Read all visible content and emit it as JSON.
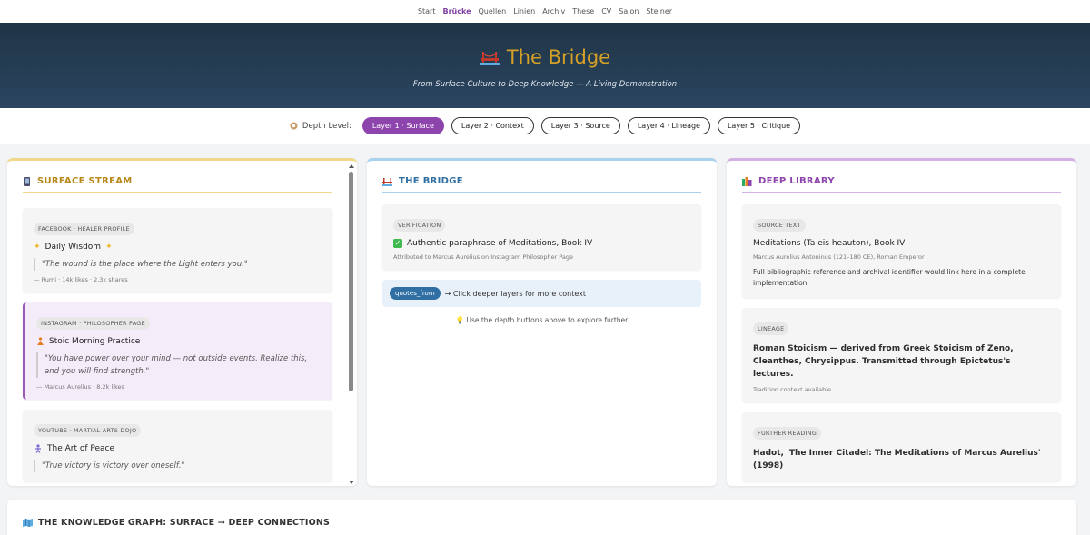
{
  "nav": {
    "items": [
      {
        "label": "Start",
        "active": false
      },
      {
        "label": "Brücke",
        "active": true
      },
      {
        "label": "Quellen",
        "active": false
      },
      {
        "label": "Linien",
        "active": false
      },
      {
        "label": "Archiv",
        "active": false
      },
      {
        "label": "These",
        "active": false
      },
      {
        "label": "CV",
        "active": false
      },
      {
        "label": "Sajon",
        "active": false
      },
      {
        "label": "Steiner",
        "active": false
      }
    ]
  },
  "hero": {
    "title": "The Bridge",
    "subtitle": "From Surface Culture to Deep Knowledge — A Living Demonstration",
    "icon": "bridge-icon"
  },
  "depth": {
    "label": "Depth Level:",
    "buttons": [
      "Layer 1 · Surface",
      "Layer 2 · Context",
      "Layer 3 · Source",
      "Layer 4 · Lineage",
      "Layer 5 · Critique"
    ],
    "active_index": 0
  },
  "surface": {
    "heading": "SURFACE STREAM",
    "cards": [
      {
        "tag": "FACEBOOK · HEALER PROFILE",
        "title": "Daily Wisdom",
        "quote": "\"The wound is the place where the Light enters you.\"",
        "meta": "— Rumi · 14k likes · 2.3k shares"
      },
      {
        "tag": "INSTAGRAM · PHILOSOPHER PAGE",
        "title": "Stoic Morning Practice",
        "quote": "\"You have power over your mind — not outside events. Realize this, and you will find strength.\"",
        "meta": "— Marcus Aurelius · 8.2k likes"
      },
      {
        "tag": "YOUTUBE · MARTIAL ARTS DOJO",
        "title": "The Art of Peace",
        "quote": "\"True victory is victory over oneself.\"",
        "meta": ""
      }
    ]
  },
  "bridge": {
    "heading": "THE BRIDGE",
    "card": {
      "tag": "VERIFICATION",
      "title": "Authentic paraphrase of Meditations, Book IV",
      "meta": "Attributed to Marcus Aurelius on Instagram Philosopher Page"
    },
    "notice_pill": "quotes_from",
    "notice_text": "→ Click deeper layers for more context",
    "hint": "Use the depth buttons above to explore further"
  },
  "library": {
    "heading": "DEEP LIBRARY",
    "cards": [
      {
        "tag": "SOURCE TEXT",
        "title": "Meditations (Ta eis heauton), Book IV",
        "meta": "Marcus Aurelius Antoninus (121–180 CE), Roman Emperor",
        "desc": "Full bibliographic reference and archival identifier would link here in a complete implementation."
      },
      {
        "tag": "LINEAGE",
        "title": "Roman Stoicism — derived from Greek Stoicism of Zeno, Cleanthes, Chrysippus. Transmitted through Epictetus's lectures.",
        "meta": "Tradition context available"
      },
      {
        "tag": "FURTHER READING",
        "title": "Hadot, 'The Inner Citadel: The Meditations of Marcus Aurelius' (1998)"
      }
    ]
  },
  "graph": {
    "heading": "THE KNOWLEDGE GRAPH: SURFACE → DEEP CONNECTIONS"
  },
  "colors": {
    "accent_purple": "#8e44ad",
    "gold": "#d4a126",
    "blue": "#2f6fa3",
    "hero_bg": "#1f3446"
  }
}
